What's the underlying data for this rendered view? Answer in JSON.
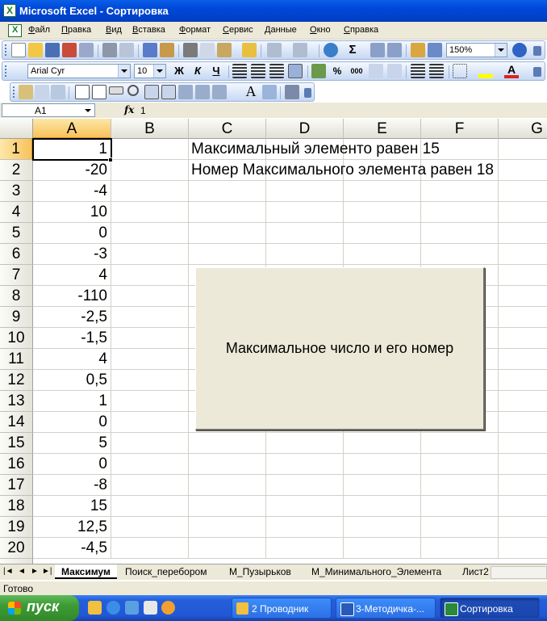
{
  "window": {
    "title": "Microsoft Excel - Сортировка"
  },
  "menu": [
    "Файл",
    "Правка",
    "Вид",
    "Вставка",
    "Формат",
    "Сервис",
    "Данные",
    "Окно",
    "Справка"
  ],
  "toolbar": {
    "zoom": "150%"
  },
  "format_toolbar": {
    "font": "Arial Cyr",
    "size": "10",
    "bold": "Ж",
    "italic": "К",
    "underline": "Ч"
  },
  "formula_bar": {
    "name_box": "A1",
    "fx": "fx",
    "formula": "1"
  },
  "columns": [
    "A",
    "B",
    "C",
    "D",
    "E",
    "F",
    "G"
  ],
  "rows": [
    "1",
    "2",
    "3",
    "4",
    "5",
    "6",
    "7",
    "8",
    "9",
    "10",
    "11",
    "12",
    "13",
    "14",
    "15",
    "16",
    "17",
    "18",
    "19",
    "20"
  ],
  "column_a": [
    "1",
    "-20",
    "-4",
    "10",
    "0",
    "-3",
    "4",
    "-110",
    "-2,5",
    "-1,5",
    "4",
    "0,5",
    "1",
    "0",
    "5",
    "0",
    "-8",
    "15",
    "12,5",
    "-4,5"
  ],
  "text_cells": {
    "c1": "Максимальный элементо равен 15",
    "c2": "Номер Максимального элемента равен 18"
  },
  "macro_button": {
    "label": "Максимальное число и его номер"
  },
  "sheet_tabs": [
    "Максимум",
    "Поиск_перебором",
    "М_Пузырьков",
    "М_Минимального_Элемента",
    "Лист2"
  ],
  "status": {
    "text": "Готово"
  },
  "taskbar": {
    "start": "пуск",
    "tasks": [
      "2 Проводник",
      "3-Методичка-...",
      "Сортировка"
    ]
  }
}
